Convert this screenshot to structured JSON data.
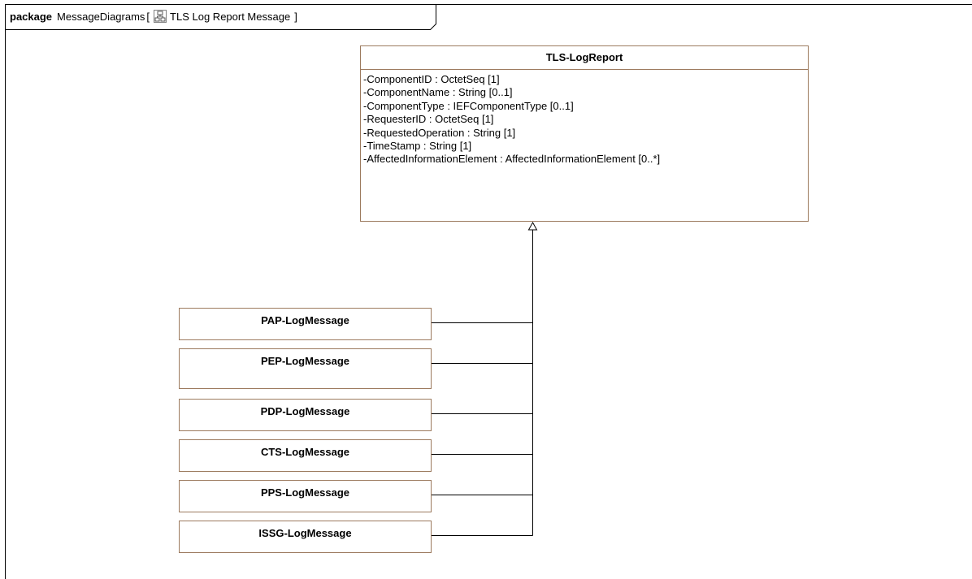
{
  "frame": {
    "keyword": "package",
    "package_name": "MessageDiagrams",
    "open_bracket": "[",
    "diagram_icon": "class-diagram-icon",
    "diagram_name": "TLS Log Report Message",
    "close_bracket": "]"
  },
  "main_class": {
    "name": "TLS-LogReport",
    "attributes": [
      "-ComponentID : OctetSeq [1]",
      "-ComponentName : String [0..1]",
      "-ComponentType : IEFComponentType [0..1]",
      "-RequesterID : OctetSeq [1]",
      "-RequestedOperation : String [1]",
      "-TimeStamp : String [1]",
      "-AffectedInformationElement : AffectedInformationElement [0..*]"
    ]
  },
  "subclasses": [
    "PAP-LogMessage",
    "PEP-LogMessage",
    "PDP-LogMessage",
    "CTS-LogMessage",
    "PPS-LogMessage",
    "ISSG-LogMessage"
  ],
  "colors": {
    "box_border": "#9c7a5e",
    "line": "#000000"
  }
}
